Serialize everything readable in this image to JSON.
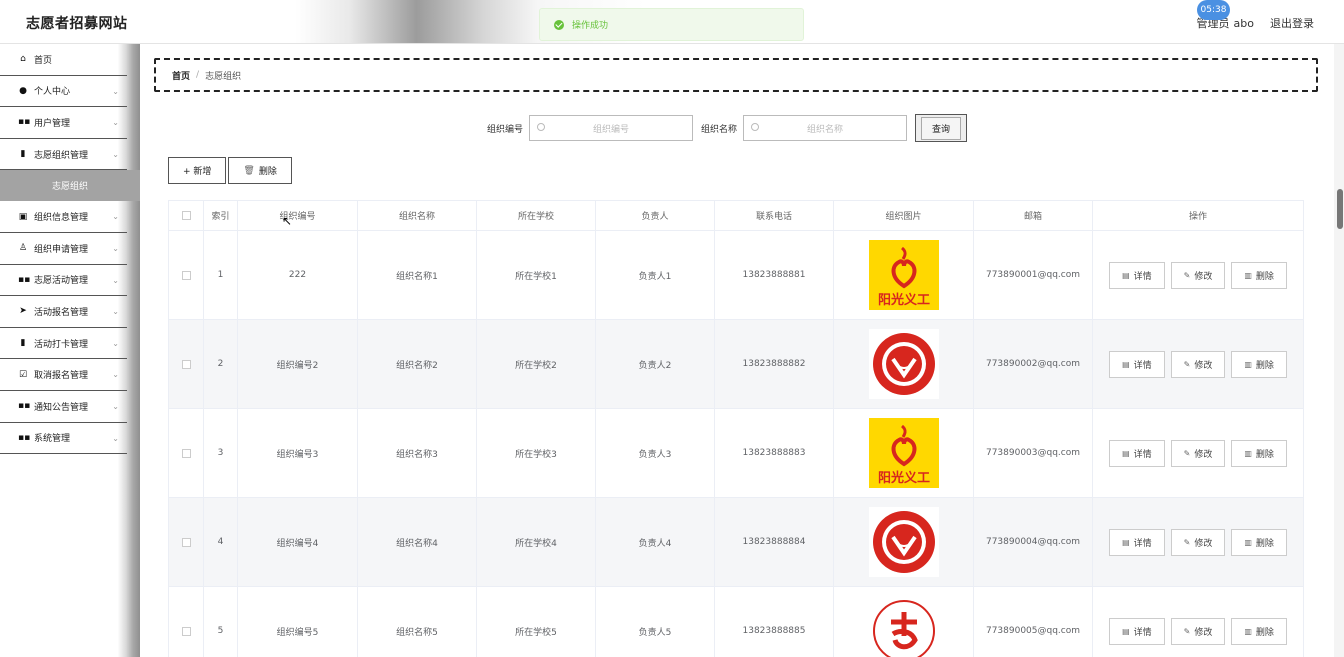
{
  "header": {
    "site_title": "志愿者招募网站",
    "toast": "操作成功",
    "role": "管理员",
    "username": "abo",
    "logout": "退出登录",
    "clock": "05:38"
  },
  "sidebar": {
    "items": [
      {
        "label": "首页",
        "icon": "home-icon",
        "glyph": "⌂",
        "chevron": false
      },
      {
        "label": "个人中心",
        "icon": "user-icon",
        "glyph": "●",
        "chevron": true
      },
      {
        "label": "用户管理",
        "icon": "grid-icon",
        "glyph": "▪▪",
        "chevron": true
      },
      {
        "label": "志愿组织管理",
        "icon": "book-icon",
        "glyph": "▮",
        "chevron": true
      },
      {
        "label": "组织信息管理",
        "icon": "doc-icon",
        "glyph": "▣",
        "chevron": true
      },
      {
        "label": "组织申请管理",
        "icon": "person-icon",
        "glyph": "♙",
        "chevron": true
      },
      {
        "label": "志愿活动管理",
        "icon": "grid-icon",
        "glyph": "▪▪",
        "chevron": true
      },
      {
        "label": "活动报名管理",
        "icon": "send-icon",
        "glyph": "➤",
        "chevron": true
      },
      {
        "label": "活动打卡管理",
        "icon": "bar-chart-icon",
        "glyph": "▮",
        "chevron": true
      },
      {
        "label": "取消报名管理",
        "icon": "checkbox-icon",
        "glyph": "☑",
        "chevron": true
      },
      {
        "label": "通知公告管理",
        "icon": "grid-icon",
        "glyph": "▪▪",
        "chevron": true
      },
      {
        "label": "系统管理",
        "icon": "grid-icon",
        "glyph": "▪▪",
        "chevron": true
      }
    ],
    "active_sub": "志愿组织"
  },
  "breadcrumb": {
    "home": "首页",
    "sep": "/",
    "current": "志愿组织"
  },
  "search": {
    "label1": "组织编号",
    "placeholder1": "组织编号",
    "label2": "组织名称",
    "placeholder2": "组织名称",
    "button": "查询"
  },
  "actions": {
    "add": "+ 新增",
    "delete": "删除"
  },
  "table": {
    "headers": [
      "索引",
      "组织编号",
      "组织名称",
      "所在学校",
      "负责人",
      "联系电话",
      "组织图片",
      "邮箱",
      "操作"
    ],
    "rows": [
      {
        "index": "1",
        "code": "222",
        "name": "组织名称1",
        "school": "所在学校1",
        "leader": "负责人1",
        "phone": "13823888881",
        "image": "sunshine-volunteer-logo",
        "email": "773890001@qq.com"
      },
      {
        "index": "2",
        "code": "组织编号2",
        "name": "组织名称2",
        "school": "所在学校2",
        "leader": "负责人2",
        "phone": "13823888882",
        "image": "red-circle-emblem",
        "email": "773890002@qq.com"
      },
      {
        "index": "3",
        "code": "组织编号3",
        "name": "组织名称3",
        "school": "所在学校3",
        "leader": "负责人3",
        "phone": "13823888883",
        "image": "sunshine-volunteer-logo",
        "email": "773890003@qq.com"
      },
      {
        "index": "4",
        "code": "组织编号4",
        "name": "组织名称4",
        "school": "所在学校4",
        "leader": "负责人4",
        "phone": "13823888884",
        "image": "red-circle-emblem",
        "email": "773890004@qq.com"
      },
      {
        "index": "5",
        "code": "组织编号5",
        "name": "组织名称5",
        "school": "所在学校5",
        "leader": "负责人5",
        "phone": "13823888885",
        "image": "volunteer-service-seal",
        "email": "773890005@qq.com"
      }
    ],
    "op_detail": "详情",
    "op_edit": "修改",
    "op_delete": "删除",
    "logo_text": "阳光义工"
  },
  "colors": {
    "success": "#67c23a",
    "logo_yellow": "#ffd800",
    "logo_red": "#d7261e"
  }
}
